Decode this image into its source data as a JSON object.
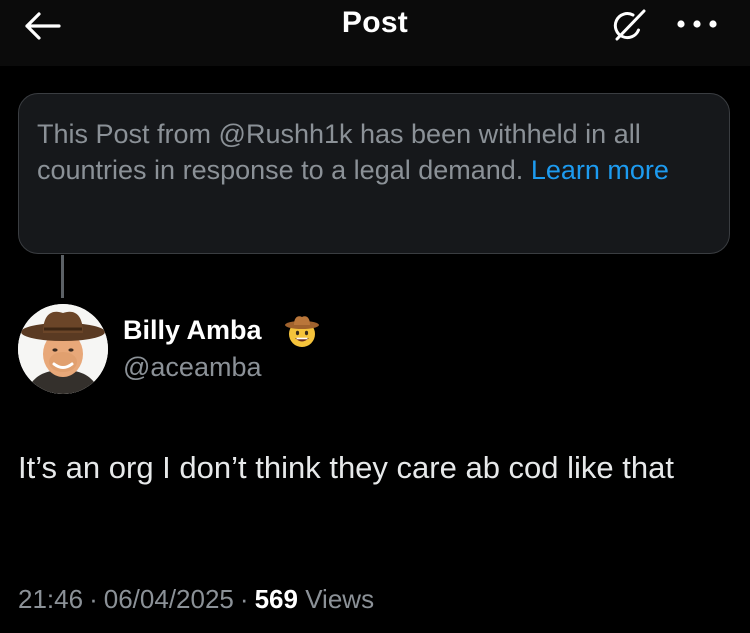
{
  "header": {
    "title": "Post",
    "back_icon": "arrow-left-icon",
    "grok_icon": "grok-icon",
    "more_icon": "more-horizontal-icon"
  },
  "withheld_notice": {
    "text": "This Post from @Rushh1k has been withheld in all countries in response to a legal demand.",
    "link_label": "Learn more"
  },
  "reply": {
    "author": {
      "display_name": "Billy Amba",
      "handle": "@aceamba",
      "badge": "cowboy-hat-face-emoji"
    },
    "text": "It’s an org I don’t think they care ab cod like that",
    "time": "21:46",
    "date": "06/04/2025",
    "views_count": "569",
    "views_label": "Views"
  },
  "colors": {
    "background": "#000000",
    "header_bg": "#0b0b0b",
    "card_bg": "#16181b",
    "card_border": "#3a3d41",
    "muted_text": "#8b9197",
    "link": "#1d9bf0",
    "primary_text": "#e7e9ea"
  }
}
